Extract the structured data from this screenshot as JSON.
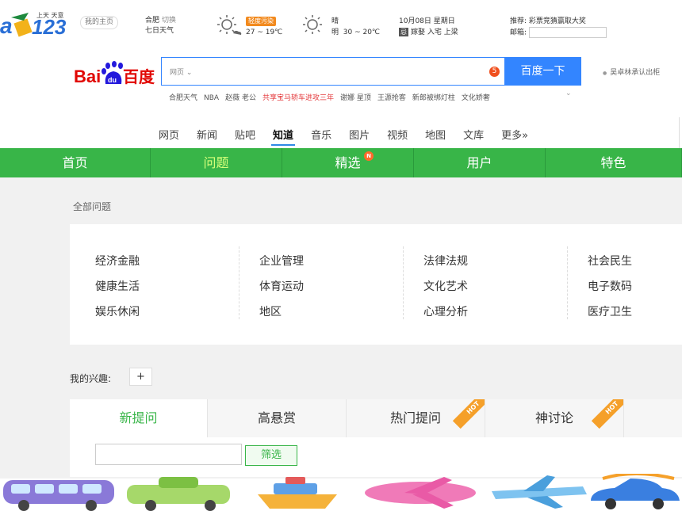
{
  "topbar": {
    "logo_tag": "上天 天意",
    "home_button": "我的主页",
    "city": "合肥",
    "switch": "切换",
    "forecast_label": "七日天气",
    "weather_today_badge": "轻度污染",
    "weather_today_temp": "27 ~ 19℃",
    "weather_tomorrow_cond": "晴",
    "weather_tomorrow_sub": "明",
    "weather_tomorrow_temp": "30 ~ 20℃",
    "date_line": "10月08日  星期日",
    "lunar_badge": "忌",
    "lunar_text": "嫁娶 入宅 上梁",
    "recommend_label": "推荐:",
    "recommend_text": "彩票竞猜赢取大奖",
    "mail_label": "邮箱:",
    "user_glyph_1": "",
    "user_glyph_2": ""
  },
  "search": {
    "type_label": "网页",
    "badge": "5",
    "button": "百度一下",
    "auth_link": "吴卓林承认出柜",
    "hot_words": [
      {
        "text": "合肥天气",
        "hot": false
      },
      {
        "text": "NBA",
        "hot": false
      },
      {
        "text": "赵薇 老公",
        "hot": false
      },
      {
        "text": "共享宝马轿车进攻三年",
        "hot": true
      },
      {
        "text": "谢娜 星顶",
        "hot": false
      },
      {
        "text": "王源抢客",
        "hot": false
      },
      {
        "text": "新郎被绑灯柱",
        "hot": false
      },
      {
        "text": "文化娇奢",
        "hot": false
      }
    ]
  },
  "zhidao_nav": [
    {
      "label": "网页",
      "active": false
    },
    {
      "label": "新闻",
      "active": false
    },
    {
      "label": "贴吧",
      "active": false
    },
    {
      "label": "知道",
      "active": true
    },
    {
      "label": "音乐",
      "active": false
    },
    {
      "label": "图片",
      "active": false
    },
    {
      "label": "视频",
      "active": false
    },
    {
      "label": "地图",
      "active": false
    },
    {
      "label": "文库",
      "active": false
    },
    {
      "label": "更多»",
      "active": false
    }
  ],
  "green_tabs": [
    {
      "label": "首页"
    },
    {
      "label": "问题"
    },
    {
      "label": "精选",
      "badge": "N"
    },
    {
      "label": "用户"
    },
    {
      "label": "特色"
    }
  ],
  "all_questions": "全部问题",
  "categories": [
    [
      "经济金融",
      "健康生活",
      "娱乐休闲"
    ],
    [
      "企业管理",
      "体育运动",
      "地区"
    ],
    [
      "法律法规",
      "文化艺术",
      "心理分析"
    ],
    [
      "社会民生",
      "电子数码",
      "医疗卫生"
    ]
  ],
  "interest_label": "我的兴趣:",
  "plus_label": "+",
  "question_tabs": [
    {
      "label": "新提问",
      "hot": false
    },
    {
      "label": "高悬赏",
      "hot": false
    },
    {
      "label": "热门提问",
      "hot": true
    },
    {
      "label": "神讨论",
      "hot": true
    }
  ],
  "hot_ribbon": "HOT",
  "filter_button": "筛选",
  "colors": {
    "green": "#38b548",
    "blue": "#3385ff",
    "hot": "#f5a02a",
    "red": "#e4393c"
  }
}
